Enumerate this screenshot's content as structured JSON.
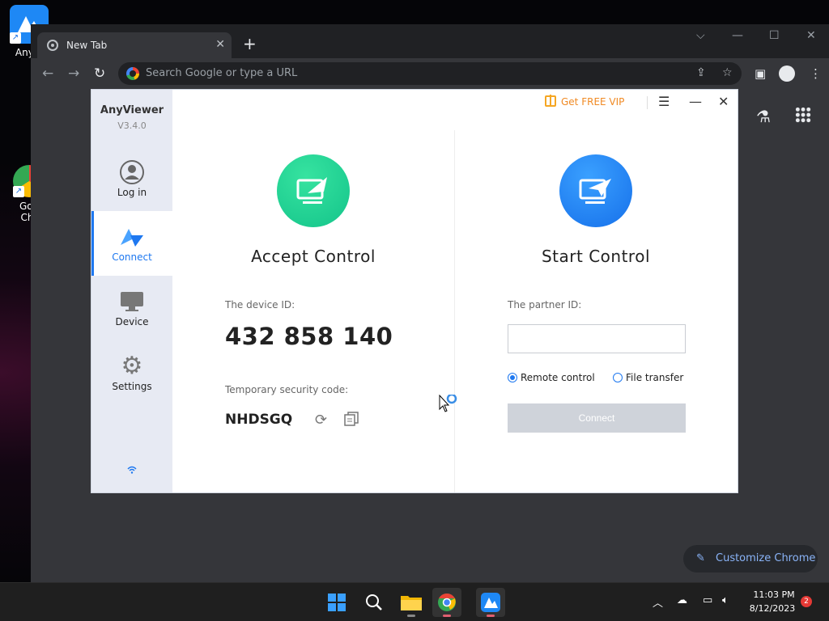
{
  "desktop": {
    "icons": [
      {
        "label": "AnyVi",
        "icon": "anyviewer-shortcut-icon"
      },
      {
        "label": "Goo Chr",
        "icon": "chrome-shortcut-icon"
      }
    ]
  },
  "chrome": {
    "tab_title": "New Tab",
    "omnibox_placeholder": "Search Google or type a URL",
    "customize_label": "Customize Chrome"
  },
  "anyviewer": {
    "app_name": "AnyViewer",
    "version": "V3.4.0",
    "vip_label": "Get FREE VIP",
    "nav": [
      {
        "label": "Log in",
        "icon": "user-icon"
      },
      {
        "label": "Connect",
        "icon": "connect-icon",
        "active": true
      },
      {
        "label": "Device",
        "icon": "monitor-icon"
      },
      {
        "label": "Settings",
        "icon": "gear-icon"
      }
    ],
    "accept": {
      "title": "Accept Control",
      "device_id_label": "The device ID:",
      "device_id": "432 858 140",
      "security_label": "Temporary security code:",
      "security_code": "NHDSGQ"
    },
    "start": {
      "title": "Start Control",
      "partner_label": "The partner ID:",
      "partner_value": "",
      "option_remote": "Remote control",
      "option_file": "File transfer",
      "selected_option": "Remote control",
      "connect_label": "Connect"
    },
    "colors": {
      "accent": "#1e78f0",
      "accept_green": "#14c48a",
      "start_blue": "#1670ea",
      "vip_orange": "#f08a24"
    }
  },
  "taskbar": {
    "apps": [
      "windows-start-icon",
      "search-icon",
      "file-explorer-icon",
      "chrome-icon",
      "anyviewer-icon"
    ],
    "time": "11:03 PM",
    "date": "8/12/2023",
    "notifications": "2"
  }
}
